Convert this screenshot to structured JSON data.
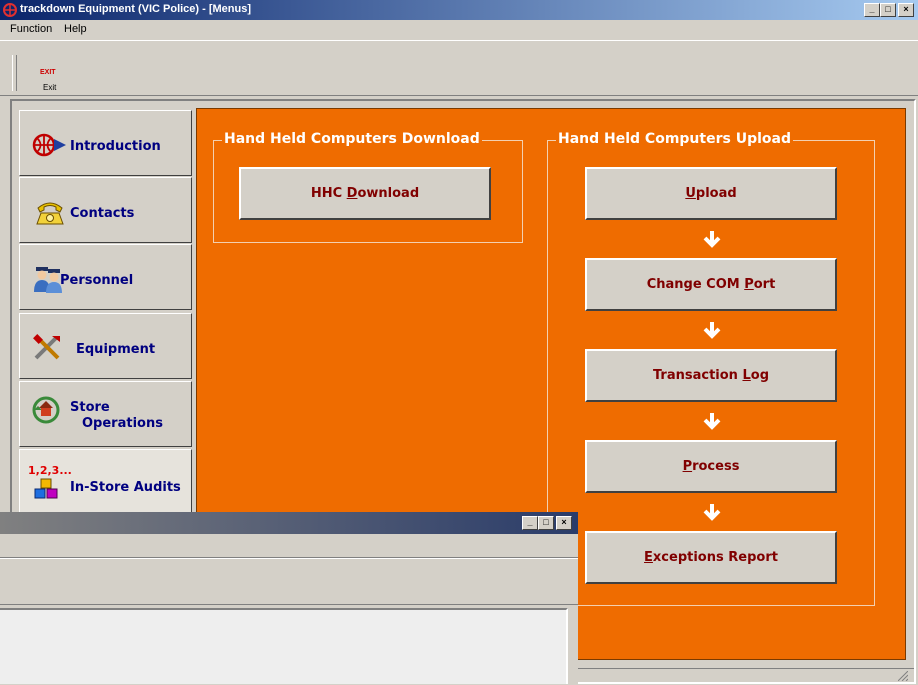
{
  "window": {
    "title": "trackdown Equipment (VIC Police) - [Menus]",
    "controls": [
      "_",
      "□",
      "×"
    ]
  },
  "menu": [
    "Function",
    "Help"
  ],
  "toolbar": {
    "exit_icon_text": "EXIT",
    "exit_label": "Exit"
  },
  "sidebar": {
    "items": [
      {
        "label": "Introduction",
        "icon": "globe-icon"
      },
      {
        "label": "Contacts",
        "icon": "telephone-icon"
      },
      {
        "label": "Personnel",
        "icon": "people-icon"
      },
      {
        "label": "Equipment",
        "icon": "tools-icon"
      },
      {
        "label_line1": "Store",
        "label_line2": "Operations",
        "icon": "store-icon"
      },
      {
        "label": "In-Store Audits",
        "badge": "1,2,3...",
        "icon": "cubes-icon"
      }
    ]
  },
  "download_group": {
    "title": "Hand Held Computers Download",
    "button": {
      "pre": "HHC ",
      "key": "D",
      "post": "ownload"
    }
  },
  "upload_group": {
    "title": "Hand Held Computers Upload",
    "buttons": [
      {
        "pre": "",
        "key": "U",
        "post": "pload"
      },
      {
        "pre": "Change COM ",
        "key": "P",
        "post": "ort"
      },
      {
        "pre": "Transaction ",
        "key": "L",
        "post": "og"
      },
      {
        "pre": "",
        "key": "P",
        "post": "rocess"
      },
      {
        "pre": "",
        "key": "E",
        "post": "xceptions Report"
      }
    ]
  },
  "child_window": {
    "controls": [
      "_",
      "□",
      "×"
    ]
  },
  "colors": {
    "panel": "#ef6c00",
    "title_bar": "#0a246a",
    "button_text": "#800000",
    "tab_text": "#000080"
  }
}
